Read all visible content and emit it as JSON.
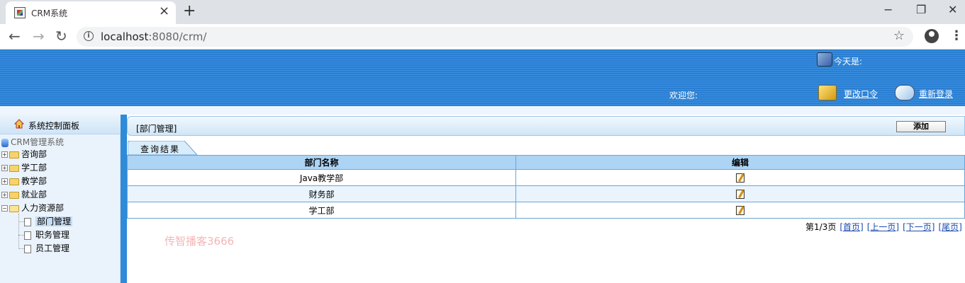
{
  "browser": {
    "tab_title": "CRM系统",
    "tab_close": "×",
    "new_tab": "+",
    "url_host": "localhost",
    "url_rest": ":8080/crm/",
    "win_min": "−",
    "win_max": "❐",
    "win_close": "✕"
  },
  "header": {
    "today_label": "今天是:",
    "welcome_label": "欢迎您:",
    "change_password": "更改口令",
    "relogin": "重新登录",
    "colors": {
      "banner": "#2a7fd3"
    }
  },
  "sidebar": {
    "title": "系统控制面板",
    "root": "CRM管理系统",
    "departments": [
      "咨询部",
      "学工部",
      "教学部",
      "就业部",
      "人力资源部"
    ],
    "hr_children": [
      "部门管理",
      "职务管理",
      "员工管理"
    ]
  },
  "main": {
    "breadcrumb": "[部门管理]",
    "add_button": "添加",
    "result_tab": "查询结果",
    "columns": [
      "部门名称",
      "编辑"
    ],
    "rows": [
      {
        "name": "Java教学部"
      },
      {
        "name": "财务部"
      },
      {
        "name": "学工部"
      }
    ],
    "pager": {
      "info": "第1/3页",
      "first": "[首页]",
      "prev": "[上一页]",
      "next": "[下一页]",
      "last": "[尾页]"
    },
    "watermark": "传智播客3666"
  }
}
